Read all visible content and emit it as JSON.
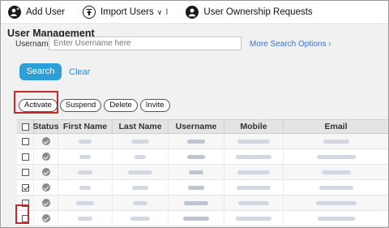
{
  "toolbar": {
    "add_user": "Add User",
    "import_users": "Import Users",
    "import_caret": "∨",
    "import_pipe": "I",
    "ownership": "User Ownership Requests"
  },
  "section": {
    "title": "User Management",
    "username_label": "Username:",
    "username_placeholder": "Enter Username here",
    "more_search": "More Search Options ›",
    "search_button": "Search",
    "clear_link": "Clear"
  },
  "actions": {
    "activate": "Activate",
    "suspend": "Suspend",
    "delete": "Delete",
    "invite": "Invite"
  },
  "table": {
    "headers": [
      "Status",
      "First Name",
      "Last Name",
      "Username",
      "Mobile",
      "Email"
    ],
    "rows": [
      {
        "checked": false,
        "status": "active"
      },
      {
        "checked": false,
        "status": "active"
      },
      {
        "checked": false,
        "status": "active"
      },
      {
        "checked": true,
        "status": "active"
      },
      {
        "checked": false,
        "status": "active"
      },
      {
        "checked": false,
        "status": "active"
      }
    ]
  },
  "colors": {
    "search_button": "#2d9fd8",
    "link": "#2d8bd3",
    "highlight": "#c62b2b"
  }
}
